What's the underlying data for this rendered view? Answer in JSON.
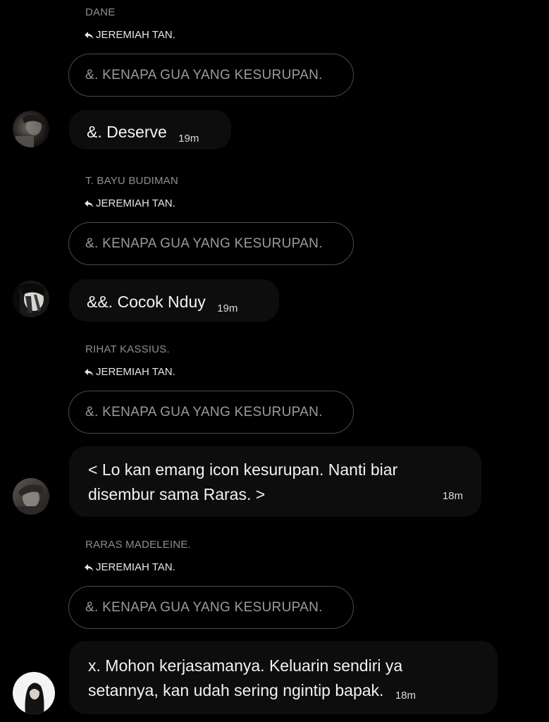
{
  "threads": [
    {
      "sender": "DANE",
      "reply_to": "JEREMIAH TAN.",
      "quoted": "&. KENAPA GUA YANG KESURUPAN.",
      "message": "&. Deserve",
      "time": "19m"
    },
    {
      "sender": "T. BAYU BUDIMAN",
      "reply_to": "JEREMIAH TAN.",
      "quoted": "&. KENAPA GUA YANG KESURUPAN.",
      "message": "&&. Cocok Nduy",
      "time": "19m"
    },
    {
      "sender": "RIHAT KASSIUS.",
      "reply_to": "JEREMIAH TAN.",
      "quoted": "&. KENAPA GUA YANG KESURUPAN.",
      "message_line1": "< Lo kan emang icon kesurupan. Nanti biar",
      "message_line2": "disembur sama Raras. >",
      "time": "18m"
    },
    {
      "sender": "RARAS MADELEINE.",
      "reply_to": "JEREMIAH TAN.",
      "quoted": "&. KENAPA GUA YANG KESURUPAN.",
      "message_line1": "x. Mohon kerjasamanya. Keluarin sendiri ya",
      "message_line2": "setannya, kan udah sering ngintip bapak.",
      "time": "18m"
    }
  ],
  "icons": {
    "reply": "reply-arrow-icon",
    "avatar": "profile-photo"
  },
  "colors": {
    "background": "#000000",
    "bubble": "#0d0d0d",
    "quoted_border": "#4a4a4a",
    "muted_text": "#8e8e8e"
  }
}
